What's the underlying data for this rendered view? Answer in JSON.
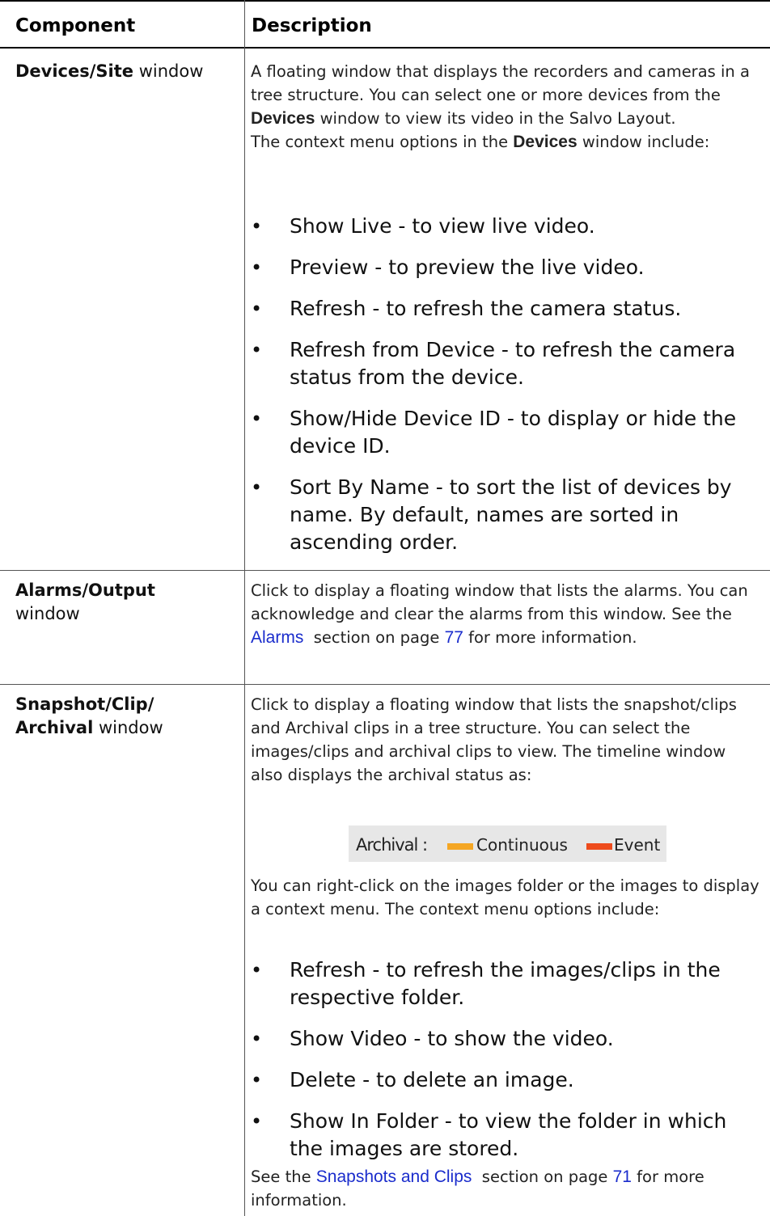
{
  "header": {
    "col1": "Component",
    "col2": "Description"
  },
  "rows": [
    {
      "component_bold": "Devices/Site",
      "component_rest": " window",
      "desc": {
        "p1a": "A floating window that displays the recorders and cameras in a tree structure. You can select one or more devices from the ",
        "p1b": "Devices",
        "p1c": " window to view its video in the Salvo Layout.",
        "p2a": "The context menu options in the ",
        "p2b": "Devices",
        "p2c": " window include:"
      },
      "bullets": [
        "Show Live - to view live video.",
        "Preview - to preview the live video.",
        "Refresh - to refresh the camera status.",
        "Refresh from Device - to refresh the camera status from the device.",
        "Show/Hide Device ID - to display or hide the device ID.",
        "Sort By Name - to sort the list of devices by name. By default, names are sorted in ascending order."
      ]
    },
    {
      "component_bold": "Alarms/Output",
      "component_rest": "window",
      "desc": {
        "a": "Click to display a floating window that lists the alarms. You can acknowledge and clear the alarms from this window. See the ",
        "link1": "Alarms",
        "b": "  section on page ",
        "link2": "77",
        "c": " for more information."
      }
    },
    {
      "component_bold1": "Snapshot/Clip/",
      "component_bold2": "Archival",
      "component_rest": " window",
      "desc": {
        "p1": "Click to display a floating window that lists the snapshot/clips and Archival clips in a tree structure. You can select the images/clips and archival clips to view. The timeline window also displays the archival status as:",
        "p2": "You can right-click on the images folder or the images to display a context menu. The context menu options include:",
        "see_a": "See the ",
        "link1": "Snapshots and Clips",
        "see_b": "  section on page ",
        "link2": "71",
        "see_c": " for more information."
      },
      "legend": {
        "label": "Archival :",
        "continuous": "Continuous",
        "event": "Event",
        "continuous_color": "#f5a623",
        "event_color": "#ee4b1c"
      },
      "bullets": [
        "Refresh - to refresh the images/clips in the respective folder.",
        "Show Video - to show the video.",
        "Delete - to delete an image.",
        "Show In Folder - to view the folder in which the images are stored."
      ]
    }
  ]
}
